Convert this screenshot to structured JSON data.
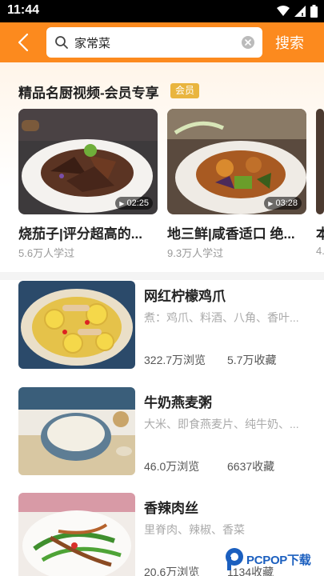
{
  "status_bar": {
    "time": "11:44"
  },
  "top_bar": {
    "search_query": "家常菜",
    "search_button": "搜索",
    "accent_color": "#fc8a1e"
  },
  "promo": {
    "title": "精品名厨视频-会员专享",
    "badge": "会员",
    "videos": [
      {
        "title": "烧茄子|评分超高的...",
        "duration": "02:25",
        "learners": "5.6万人学过"
      },
      {
        "title": "地三鲜|咸香适口 绝...",
        "duration": "03:28",
        "learners": "9.3万人学过"
      },
      {
        "title": "本",
        "learners": "4."
      }
    ]
  },
  "recipes": [
    {
      "title": "网红柠檬鸡爪",
      "ingredients": "煮：鸡爪、料酒、八角、香叶...",
      "views": "322.7万浏览",
      "favorites": "5.7万收藏"
    },
    {
      "title": "牛奶燕麦粥",
      "ingredients": "大米、即食燕麦片、纯牛奶、...",
      "views": "46.0万浏览",
      "favorites": "6637收藏"
    },
    {
      "title": "香辣肉丝",
      "ingredients": "里脊肉、辣椒、香菜",
      "views": "20.6万浏览",
      "favorites": "1134收藏"
    }
  ],
  "watermark": {
    "text": "PCPOP下载"
  }
}
